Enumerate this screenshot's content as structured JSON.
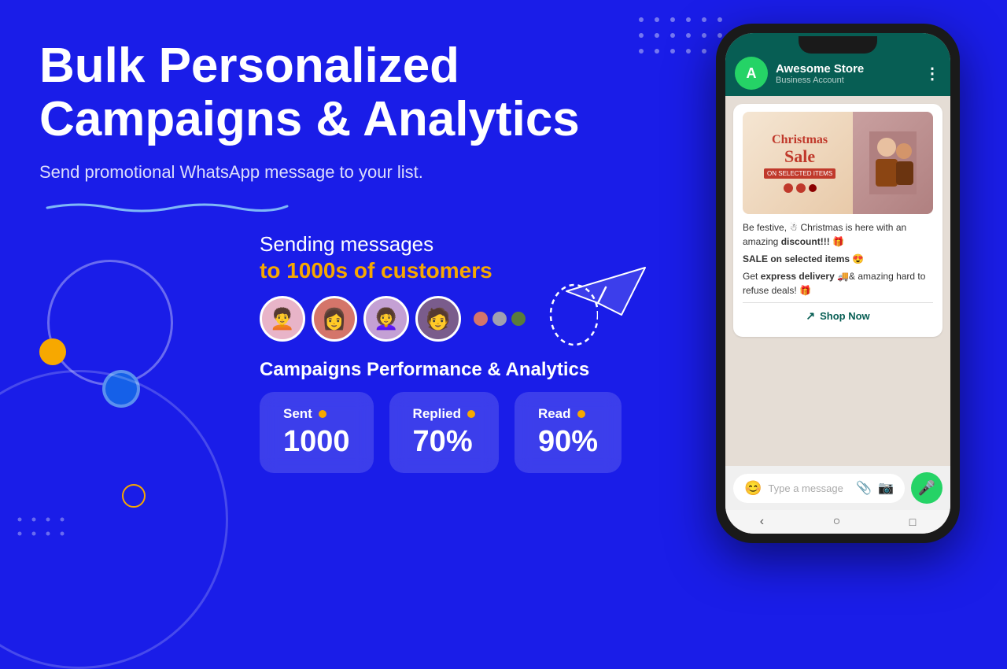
{
  "page": {
    "bg_color": "#1a1de8"
  },
  "hero": {
    "title_line1": "Bulk Personalized",
    "title_line2": "Campaigns & Analytics",
    "subtitle": "Send promotional WhatsApp message to your list."
  },
  "sending": {
    "label": "Sending messages",
    "highlight": "to 1000s of customers"
  },
  "avatars": [
    {
      "id": "a1",
      "emoji": "👩",
      "bg": "#e8b4c8"
    },
    {
      "id": "a2",
      "emoji": "👩",
      "bg": "#d4756a"
    },
    {
      "id": "a3",
      "emoji": "👩",
      "bg": "#c4a0d4"
    },
    {
      "id": "a4",
      "emoji": "🧑",
      "bg": "#7a5c8c"
    }
  ],
  "extra_dots": [
    {
      "color": "#d4756a"
    },
    {
      "color": "#a0a0b0"
    },
    {
      "color": "#5a7c3a"
    }
  ],
  "analytics": {
    "title": "Campaigns Performance & Analytics",
    "stats": [
      {
        "label": "Sent",
        "value": "1000",
        "dot_color": "#f7a800"
      },
      {
        "label": "Replied",
        "value": "70%",
        "dot_color": "#f7a800"
      },
      {
        "label": "Read",
        "value": "90%",
        "dot_color": "#f7a800"
      }
    ]
  },
  "phone": {
    "wa_name": "Awesome Store",
    "wa_status": "Business Account",
    "wa_avatar_letter": "A",
    "promo_christmas_text": "Christmas",
    "promo_sale_text": "Sale",
    "promo_on_selected": "ON SELECTED ITEMS",
    "message1": "Be festive, ☃ Christmas is here with an amazing discount!!! 🎁",
    "message2_prefix": "SALE on selected items 😍",
    "message3": "Get express delivery 🚚& amazing hard to refuse deals! 🎁",
    "shop_now": "Shop Now",
    "input_placeholder": "Type a message"
  },
  "icons": {
    "mic": "🎤",
    "emoji": "😊",
    "attachment": "📎",
    "camera": "📷",
    "external_link": "↗"
  }
}
